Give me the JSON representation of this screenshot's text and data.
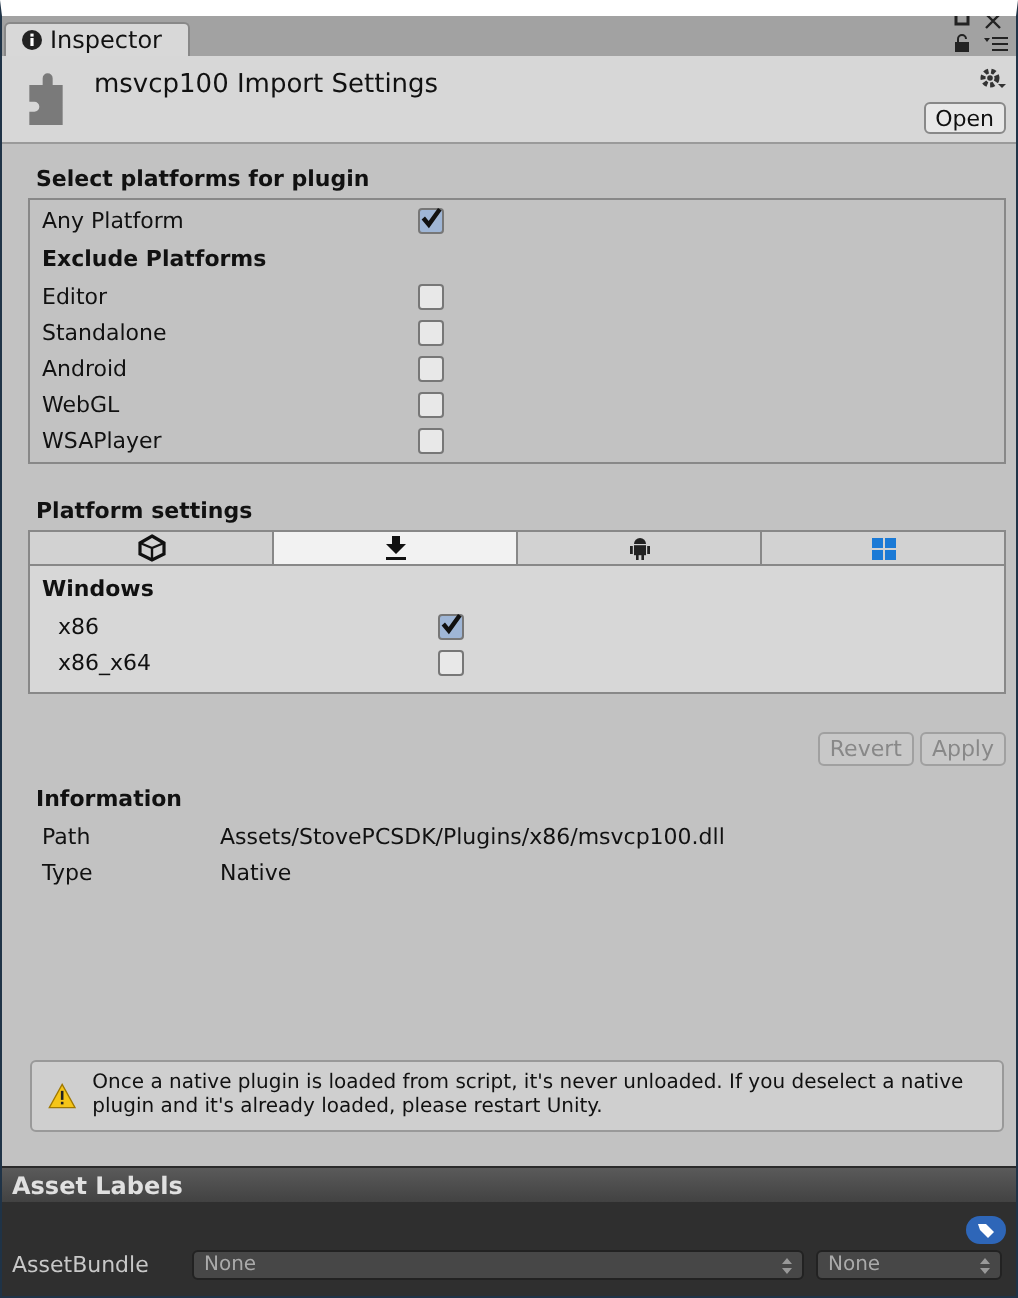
{
  "tab": {
    "label": "Inspector",
    "selected": true
  },
  "header": {
    "title": "msvcp100 Import Settings",
    "open_button": "Open"
  },
  "select_platforms": {
    "heading": "Select platforms for plugin",
    "any_platform": {
      "label": "Any Platform",
      "checked": true
    },
    "exclude_heading": "Exclude Platforms",
    "excludes": [
      {
        "label": "Editor",
        "checked": false
      },
      {
        "label": "Standalone",
        "checked": false
      },
      {
        "label": "Android",
        "checked": false
      },
      {
        "label": "WebGL",
        "checked": false
      },
      {
        "label": "WSAPlayer",
        "checked": false
      }
    ]
  },
  "platform_settings": {
    "heading": "Platform settings",
    "tabs": [
      {
        "kind": "unity",
        "selected": false
      },
      {
        "kind": "download",
        "selected": true
      },
      {
        "kind": "android",
        "selected": false
      },
      {
        "kind": "windows",
        "selected": false
      }
    ],
    "section": "Windows",
    "options": [
      {
        "label": "x86",
        "checked": true
      },
      {
        "label": "x86_x64",
        "checked": false
      }
    ]
  },
  "buttons": [
    {
      "label": "Revert",
      "disabled": true
    },
    {
      "label": "Apply",
      "disabled": true
    }
  ],
  "information": {
    "heading": "Information",
    "rows": [
      {
        "label": "Path",
        "value": "Assets/StovePCSDK/Plugins/x86/msvcp100.dll"
      },
      {
        "label": "Type",
        "value": "Native"
      }
    ]
  },
  "warning": "Once a native plugin is loaded from script, it's never unloaded. If you deselect a native plugin and it's already loaded, please restart Unity.",
  "asset_labels": {
    "heading": "Asset Labels",
    "bundle_label": "AssetBundle",
    "bundle_name": "None",
    "bundle_variant": "None"
  }
}
